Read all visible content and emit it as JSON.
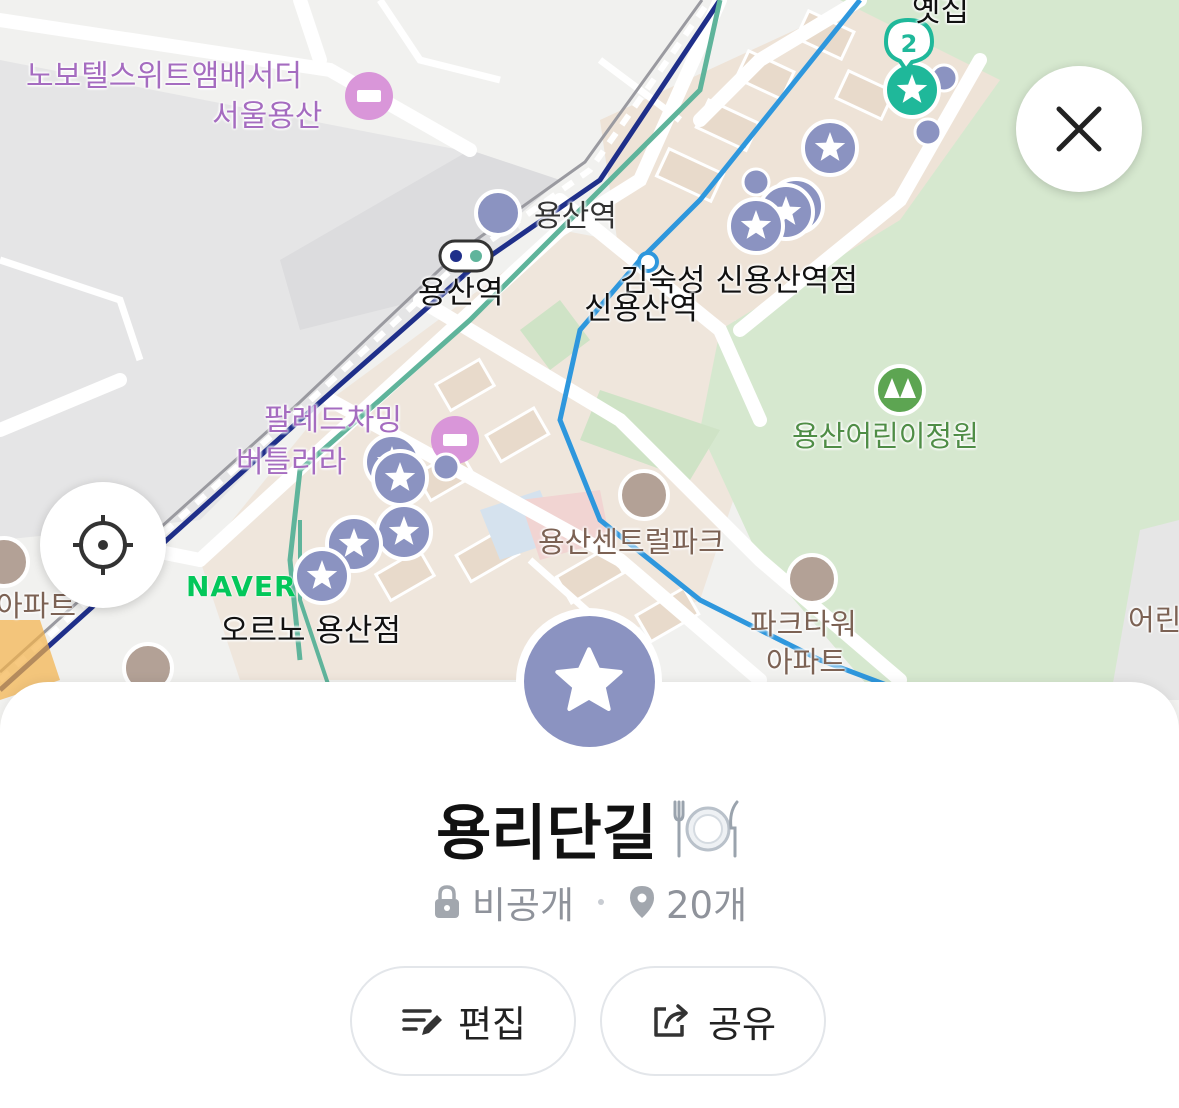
{
  "map": {
    "labels": {
      "novotel_line1": "노보텔스위트앰배서더",
      "novotel_line2": "서울용산",
      "yongsan_station_top": "용산역",
      "yongsan_station_main": "용산역",
      "shinyongsan_shop": "김숙성 신용산역점",
      "shinyongsan_station": "신용산역",
      "palladchaming_line1": "팔레드차밍",
      "palladchaming_line2": "버틀러라",
      "children_garden": "용산어린이정원",
      "central_park": "용산센트럴파크",
      "parktower_line1": "파크타워",
      "parktower_line2": "아파트",
      "orno": "오르노 용산점",
      "apartment_left": "아파트",
      "children_right": "어린",
      "yetjip": "옛집",
      "cluster_count": "2"
    },
    "naver_logo": "NAVER"
  },
  "controls": {
    "close_icon": "close-icon",
    "locate_icon": "crosshair-icon"
  },
  "sheet": {
    "title": "용리단길",
    "title_emoji": "plate-cutlery-icon",
    "privacy": "비공개",
    "count": "20개",
    "edit_label": "편집",
    "share_label": "공유"
  },
  "colors": {
    "marker": "#8b93c1",
    "marker_active": "#1fb89a",
    "line1": "#1f2f8a",
    "line_gyeongui": "#5fb49b",
    "line4": "#2e97dd",
    "park": "#d6e8cf"
  }
}
